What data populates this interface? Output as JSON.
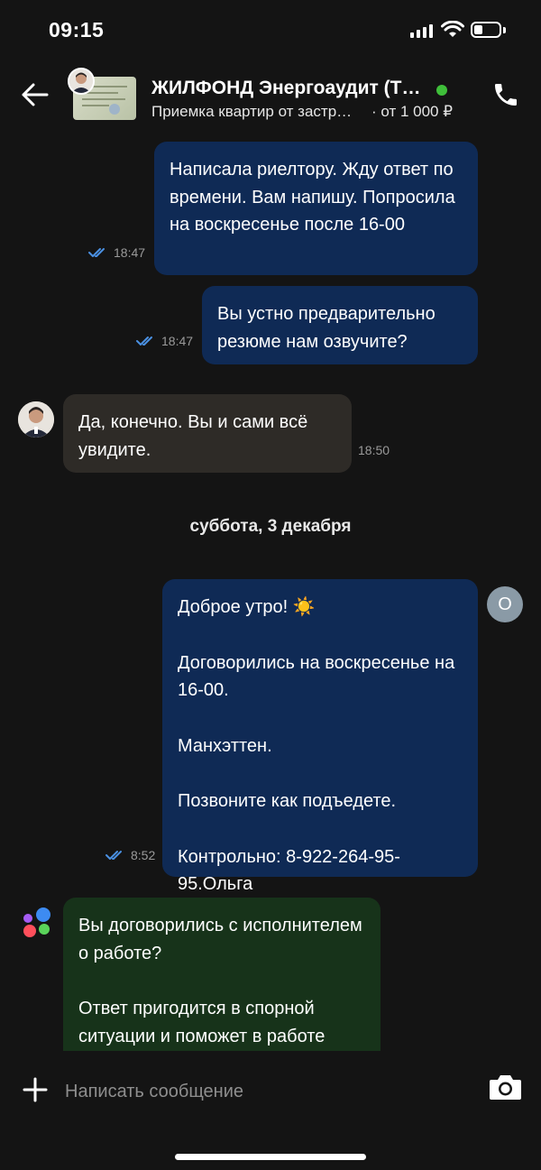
{
  "status_bar": {
    "time": "09:15"
  },
  "header": {
    "title": "ЖИЛФОНД Энергоаудит (Т…",
    "subtitle": "Приемка квартир от застр…",
    "price": "· от 1 000 ₽",
    "online_color": "#3fbf3a",
    "icons": [
      "back-arrow-icon",
      "phone-icon"
    ]
  },
  "messages": [
    {
      "from": "me",
      "text": "Написала риелтору. Жду ответ по времени. Вам напишу. Попросила на воскресенье после 16-00",
      "time": "18:47",
      "read": true
    },
    {
      "from": "me",
      "text": "Вы устно предварительно резюме нам озвучите?",
      "time": "18:47",
      "read": true
    },
    {
      "from": "contact",
      "text": "Да, конечно. Вы и сами всё увидите.",
      "time": "18:50"
    },
    {
      "from": "me",
      "paragraphs": [
        "Доброе утро! ☀️",
        "Договорились на воскресенье на 16-00.",
        "Манхэттен.",
        "Позвоните как подъедете.",
        "Контрольно: 8-922-264-95-95.Ольга"
      ],
      "time": "8:52",
      "read": true,
      "avatar_letter": "О"
    },
    {
      "from": "bot",
      "paragraphs": [
        "Вы договорились с исполнителем о работе?",
        "Ответ пригодится в спорной ситуации и поможет в работе"
      ]
    }
  ],
  "date_separator": "суббота, 3 декабря",
  "composer": {
    "placeholder": "Написать сообщение"
  },
  "colors": {
    "outgoing": "#0f2a55",
    "incoming": "#2e2b27",
    "bot": "#17331a",
    "read_checks": "#4a90e2"
  }
}
